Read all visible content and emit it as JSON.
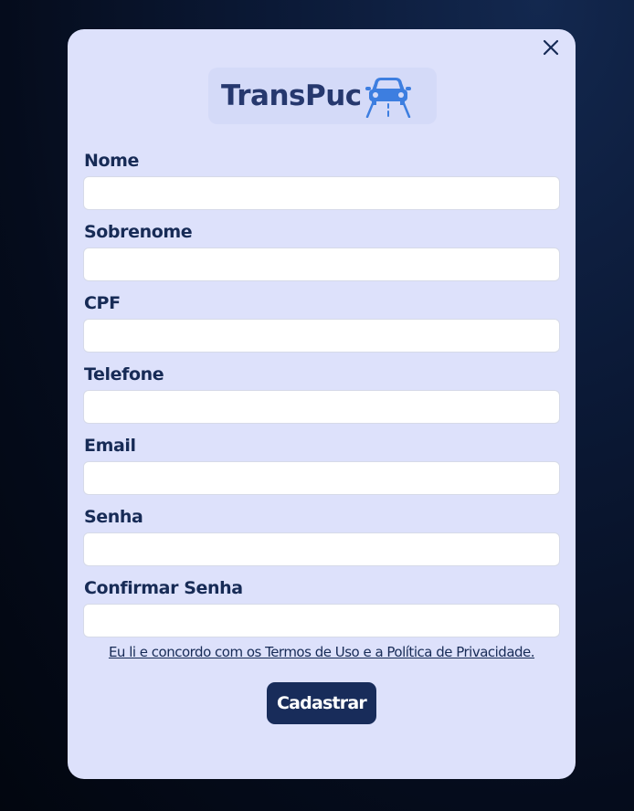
{
  "modal": {
    "close_label": "X",
    "logo": {
      "text": "TransPuc",
      "icon": "car-road-icon"
    },
    "fields": [
      {
        "label": "Nome",
        "value": "",
        "placeholder": ""
      },
      {
        "label": "Sobrenome",
        "value": "",
        "placeholder": ""
      },
      {
        "label": "CPF",
        "value": "",
        "placeholder": ""
      },
      {
        "label": "Telefone",
        "value": "",
        "placeholder": ""
      },
      {
        "label": "Email",
        "value": "",
        "placeholder": ""
      },
      {
        "label": "Senha",
        "value": "",
        "placeholder": ""
      },
      {
        "label": "Confirmar Senha",
        "value": "",
        "placeholder": ""
      }
    ],
    "terms_text": "Eu li e concordo com os Termos de Uso e a Política de Privacidade.",
    "submit_label": "Cadastrar"
  },
  "colors": {
    "background": "#0b1936",
    "modal_bg": "#dde1fb",
    "text": "#172b56",
    "button_bg": "#182c5a",
    "logo_text": "#26386e",
    "logo_icon": "#3d7ee0"
  }
}
